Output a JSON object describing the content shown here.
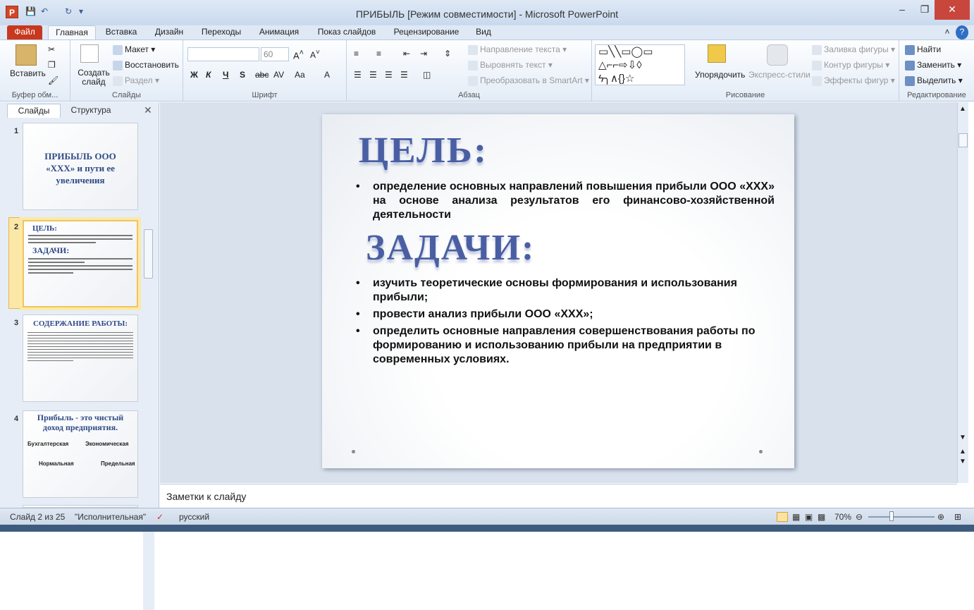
{
  "window": {
    "title": "ПРИБЫЛЬ [Режим совместимости]  -  Microsoft PowerPoint",
    "app_icon": "P"
  },
  "tabs": [
    "Файл",
    "Главная",
    "Вставка",
    "Дизайн",
    "Переходы",
    "Анимация",
    "Показ слайдов",
    "Рецензирование",
    "Вид"
  ],
  "ribbon": {
    "clipboard": {
      "paste": "Вставить",
      "label": "Буфер обм..."
    },
    "slides": {
      "new_slide": "Создать слайд",
      "layout": "Макет",
      "reset": "Восстановить",
      "section": "Раздел",
      "label": "Слайды"
    },
    "font": {
      "size": "60",
      "bold": "Ж",
      "italic": "К",
      "underline": "Ч",
      "strike": "S",
      "label": "Шрифт"
    },
    "paragraph": {
      "direction": "Направление текста",
      "align": "Выровнять текст",
      "smartart": "Преобразовать в SmartArt",
      "label": "Абзац"
    },
    "drawing": {
      "arrange": "Упорядочить",
      "styles": "Экспресс-стили",
      "fill": "Заливка фигуры",
      "outline": "Контур фигуры",
      "effects": "Эффекты фигур",
      "label": "Рисование"
    },
    "editing": {
      "find": "Найти",
      "replace": "Заменить",
      "select": "Выделить",
      "label": "Редактирование"
    }
  },
  "pane": {
    "tab_slides": "Слайды",
    "tab_structure": "Структура"
  },
  "thumbs": [
    {
      "num": "1",
      "title": "ПРИБЫЛЬ ООО «ХХХ» и пути ее увеличения"
    },
    {
      "num": "2",
      "title": "ЦЕЛЬ:",
      "subtitle": "ЗАДАЧИ:"
    },
    {
      "num": "3",
      "title": "СОДЕРЖАНИЕ РАБОТЫ:"
    },
    {
      "num": "4",
      "title": "Прибыль - это чистый доход предприятия.",
      "a": "Бухгалтерская",
      "b": "Экономическая",
      "c": "Нормальная",
      "d": "Предельная"
    }
  ],
  "slide": {
    "heading1": "ЦЕЛЬ:",
    "goal": "определение основных направлений повышения прибыли ООО «ХХХ» на основе анализа результатов его финансово-хозяйственной деятельности",
    "heading2": "ЗАДАЧИ:",
    "tasks": [
      "изучить теоретические основы формирования и использования прибыли;",
      "провести анализ прибыли ООО «ХХХ»;",
      "определить основные направления совершенствования работы по формированию и использованию прибыли на предприятии в современных условиях."
    ]
  },
  "notes": {
    "placeholder": "Заметки к слайду"
  },
  "status": {
    "slide": "Слайд 2 из 25",
    "theme": "\"Исполнительная\"",
    "lang": "русский",
    "zoom": "70%"
  }
}
